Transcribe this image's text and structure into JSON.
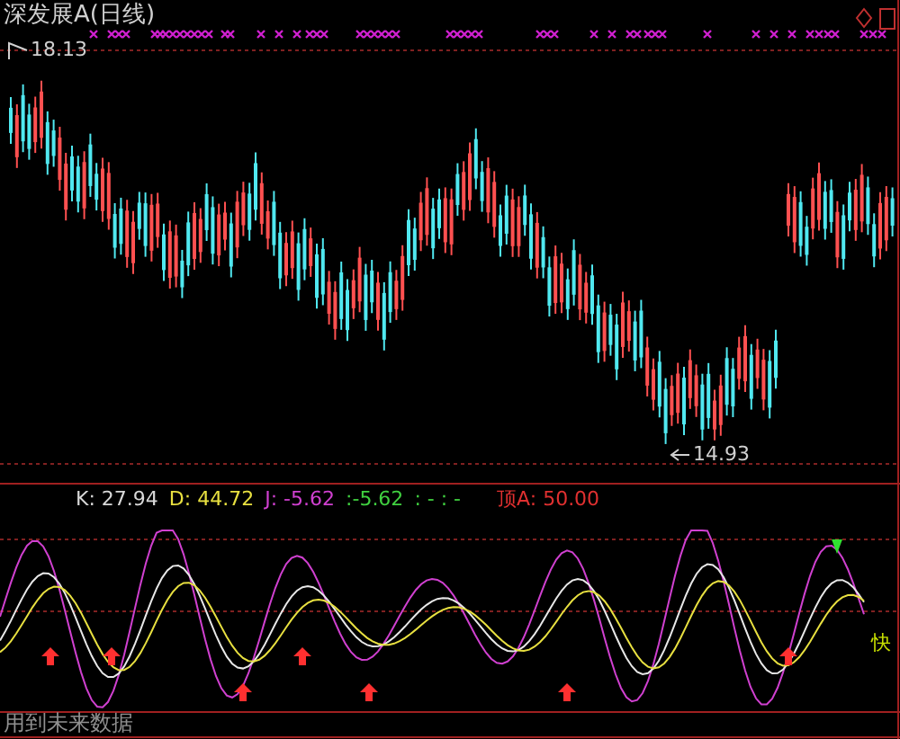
{
  "main_chart": {
    "title": "深发展A(日线)",
    "high_label": "18.13",
    "low_label": "14.93"
  },
  "indicator": {
    "readouts": [
      {
        "text": "K: 27.94",
        "color": "#d8d8d8"
      },
      {
        "text": "D: 44.72",
        "color": "#e8e040"
      },
      {
        "text": "J: -5.62",
        "color": "#d040d0"
      },
      {
        "text": ":-5.62",
        "color": "#40d040"
      },
      {
        "text": ": - : -",
        "color": "#40d040"
      },
      {
        "text": "顶A: 50.00",
        "color": "#e03030"
      }
    ],
    "signal_label": "快",
    "warning": "用到未来数据"
  }
}
